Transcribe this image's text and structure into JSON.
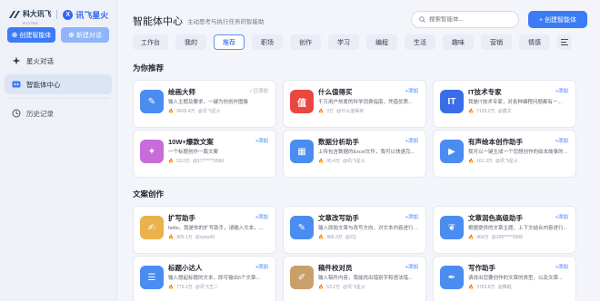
{
  "brand": {
    "name1": "科大讯飞",
    "name1_sub": "iFLYTEK",
    "name2": "讯飞星火",
    "name2_mark": "X"
  },
  "sidebar": {
    "create_agent": "创建智能体",
    "new_chat": "新建对话",
    "nav": [
      {
        "label": "星火对话",
        "icon": "spark-chat-icon"
      },
      {
        "label": "智能体中心",
        "icon": "agent-center-icon"
      }
    ],
    "history": "历史记录"
  },
  "header": {
    "title": "智能体中心",
    "subtitle": "主动思考与执行任务的智能助",
    "search_placeholder": "搜索智能体...",
    "create_button": "+ 创建智能体"
  },
  "tabs": [
    "工作台",
    "我的",
    "推荐",
    "职场",
    "创作",
    "学习",
    "编程",
    "生活",
    "趣味",
    "营销",
    "情感"
  ],
  "active_tab": "推荐",
  "sections": [
    {
      "title": "为你推荐",
      "cards": [
        {
          "name": "绘画大师",
          "desc": "输入主题及要求，一键为你创作图像",
          "count": "9435.4万",
          "author": "@讯飞星火",
          "action": "已添加",
          "added": true,
          "color": "#4a8cf0"
        },
        {
          "name": "什么值得买",
          "desc": "千万用户热爱的科学消费指南，凭借优质...",
          "count": "3万",
          "author": "@什么值得买",
          "action": "添加",
          "added": false,
          "color": "#e8483f"
        },
        {
          "name": "IT技术专家",
          "desc": "我是IT技术专家，对各种编程问题都有一...",
          "count": "7133.2万",
          "author": "@鑫文",
          "action": "添加",
          "added": false,
          "color": "#3a6ee8"
        },
        {
          "name": "10W+爆款文案",
          "desc": "一个标题创作一篇文案",
          "count": "53.2万",
          "author": "@177*****9560",
          "action": "添加",
          "added": false,
          "color": "#c86cd9"
        },
        {
          "name": "数据分析助手",
          "desc": "上传包含数据的Excel文件，我可以快速完...",
          "count": "95.4万",
          "author": "@讯飞星火",
          "action": "添加",
          "added": false,
          "color": "#4a8cf0"
        },
        {
          "name": "有声绘本创作助手",
          "desc": "我可以一键生成一个您想创作的绘本故事的主角...",
          "count": "161.3万",
          "author": "@讯飞星火",
          "action": "添加",
          "added": false,
          "color": "#4a8cf0"
        }
      ]
    },
    {
      "title": "文案创作",
      "cards": [
        {
          "name": "扩写助手",
          "desc": "hello，我是你的扩写助手，请输入文本，...",
          "count": "905.1万",
          "author": "@xyeu49",
          "action": "添加",
          "added": false,
          "color": "#e9b24a"
        },
        {
          "name": "文章改写助手",
          "desc": "输入原始文章与改写方向，对文本内容进行修改润色...",
          "count": "968.3万",
          "author": "@ZQ",
          "action": "添加",
          "added": false,
          "color": "#4a8cf0"
        },
        {
          "name": "文章润色高级助手",
          "desc": "根据提供的文章主题、上下文结合内容进行...",
          "count": "964万",
          "author": "@189*****5588",
          "action": "添加",
          "added": false,
          "color": "#4a8cf0"
        },
        {
          "name": "标题小达人",
          "desc": "输入想起标题的文本，即可输出5个文章...",
          "count": "779.2万",
          "author": "@讯飞王二",
          "action": "添加",
          "added": false,
          "color": "#4a8cf0"
        },
        {
          "name": "稿件校对员",
          "desc": "输入稿件内容，我能找出错别字和语法错...",
          "count": "53.2万",
          "author": "@讯飞星火",
          "action": "添加",
          "added": false,
          "color": "#c9a06a"
        },
        {
          "name": "写作助手",
          "desc": "请说出您要创作的文章的类型，以及文章...",
          "count": "3763.8万",
          "author": "@舞蹈",
          "action": "添加",
          "added": false,
          "color": "#4a8cf0"
        }
      ]
    }
  ]
}
